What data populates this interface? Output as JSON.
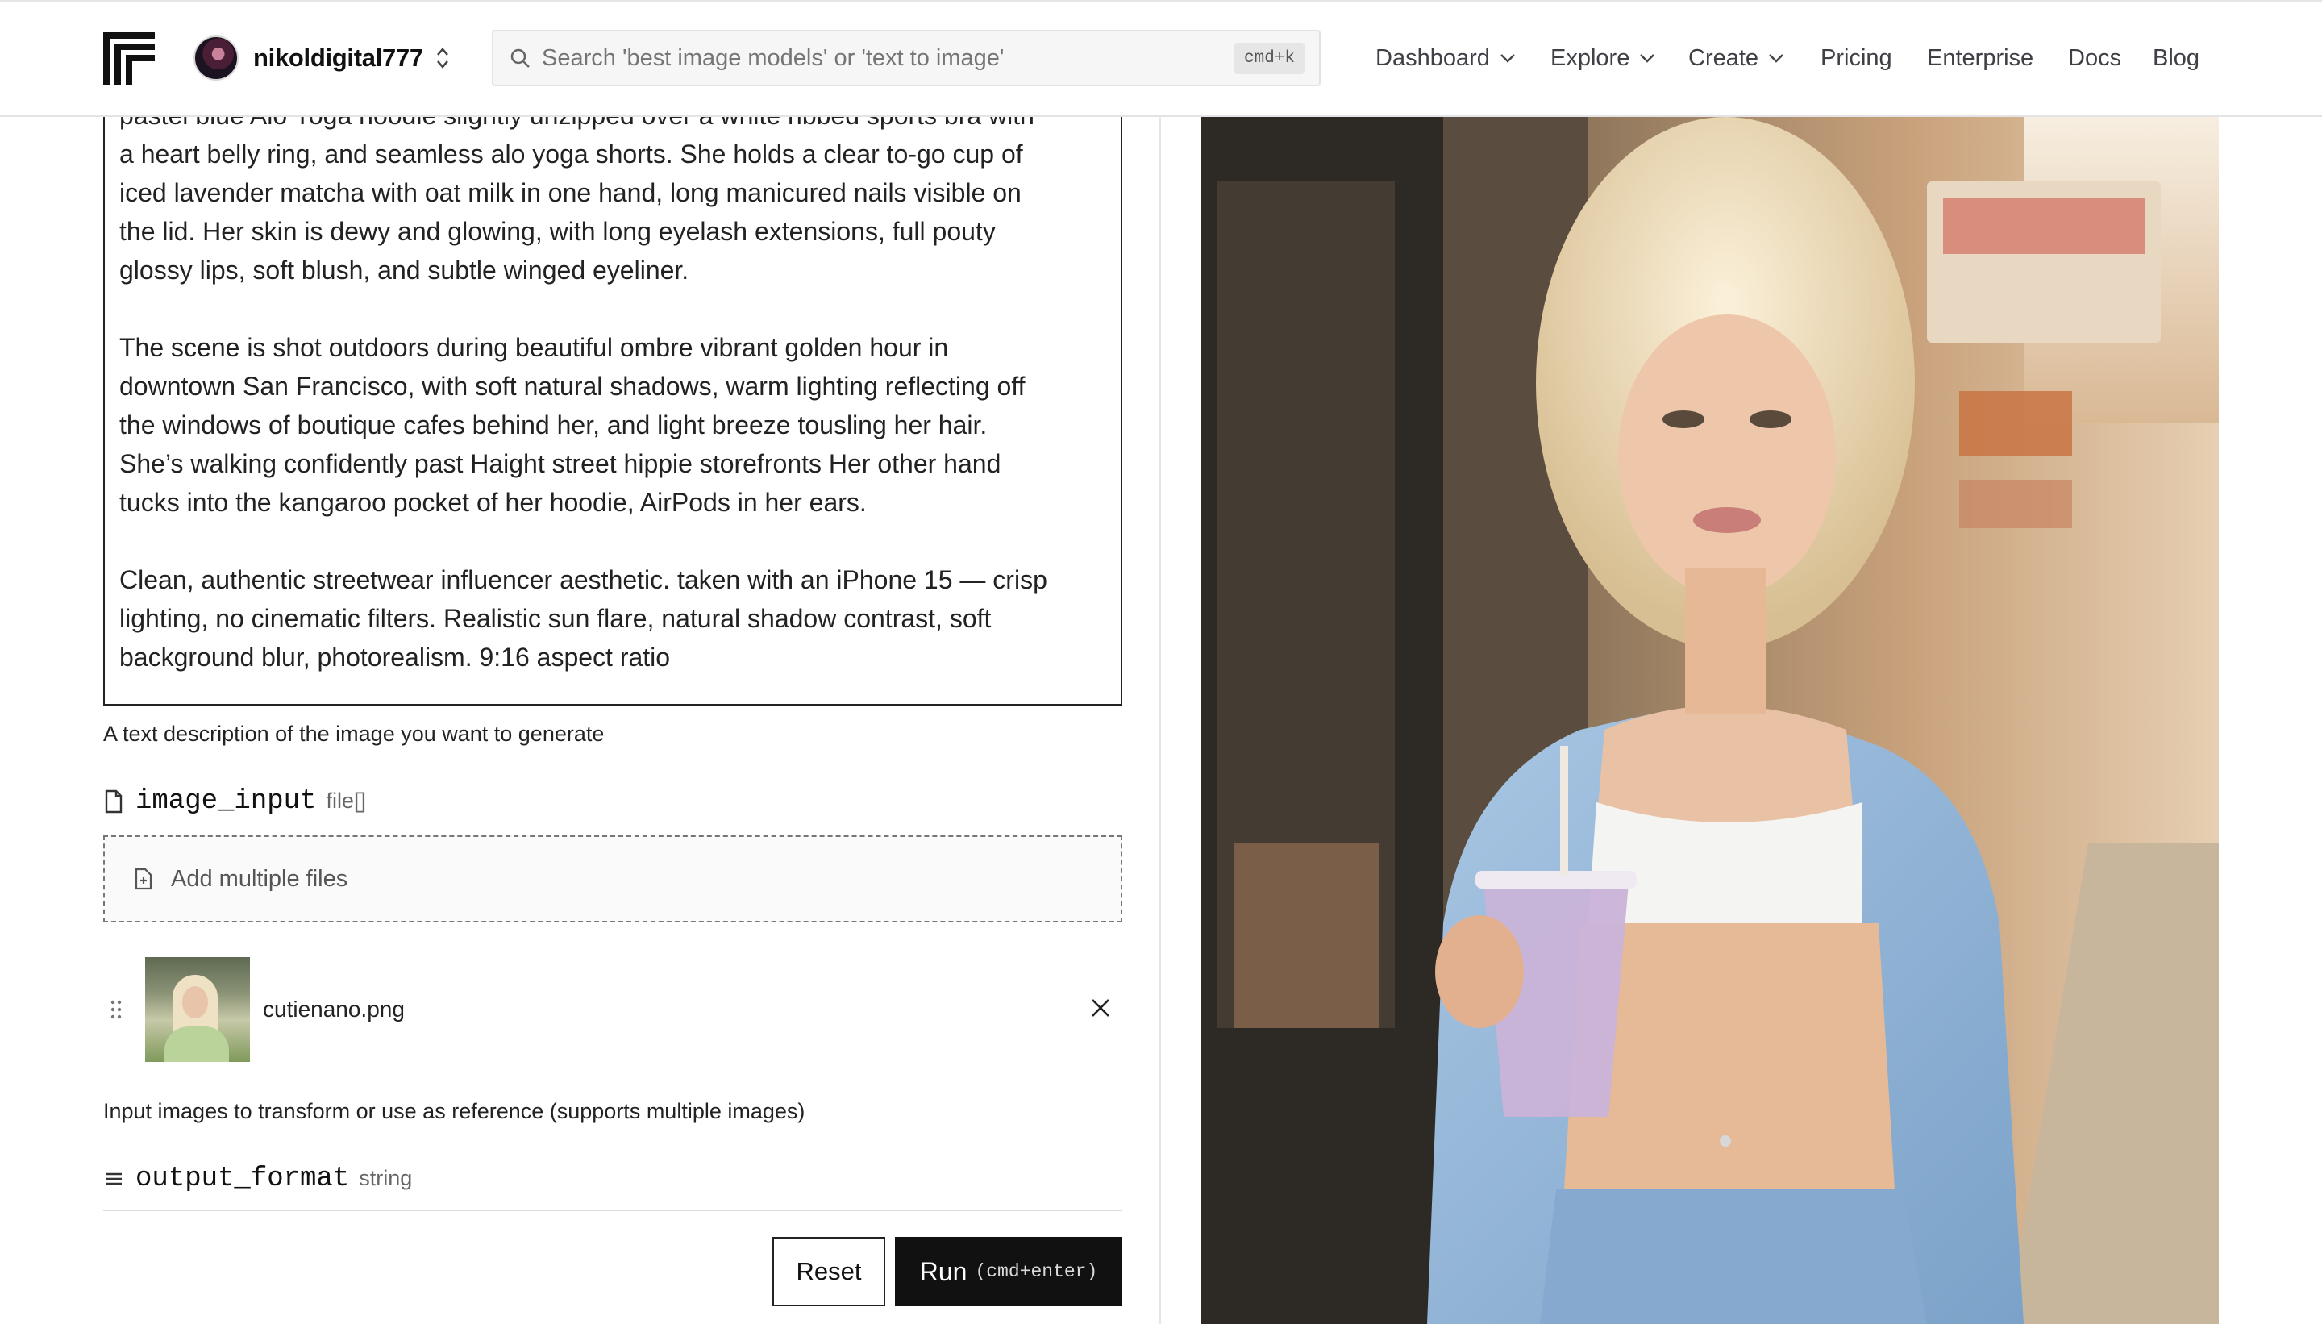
{
  "header": {
    "username": "nikoldigital777",
    "search_placeholder": "Search 'best image models' or 'text to image'",
    "search_shortcut": "cmd+k",
    "nav": [
      {
        "label": "Dashboard",
        "dropdown": true
      },
      {
        "label": "Explore",
        "dropdown": true
      },
      {
        "label": "Create",
        "dropdown": true
      },
      {
        "label": "Pricing",
        "dropdown": false
      },
      {
        "label": "Enterprise",
        "dropdown": false
      },
      {
        "label": "Docs",
        "dropdown": false
      },
      {
        "label": "Blog",
        "dropdown": false
      }
    ]
  },
  "form": {
    "prompt_value": "pastel blue Alo Yoga hoodie slightly unzipped over a white ribbed sports bra with\na heart belly ring, and seamless alo yoga shorts. She holds a clear to-go cup of\niced lavender matcha with oat milk in one hand, long manicured nails visible on\nthe lid. Her skin is dewy and glowing, with long eyelash extensions, full pouty\nglossy lips, soft blush, and subtle winged eyeliner.\n\nThe scene is shot outdoors during beautiful ombre vibrant golden hour in\ndowntown San Francisco, with soft natural shadows, warm lighting reflecting off\nthe windows of boutique cafes behind her, and light breeze tousling her hair.\nShe’s walking confidently past Haight street hippie storefronts Her other hand\ntucks into the kangaroo pocket of her hoodie, AirPods in her ears.\n\nClean, authentic streetwear influencer aesthetic. taken with an iPhone 15 — crisp\nlighting, no cinematic filters. Realistic sun flare, natural shadow contrast, soft\nbackground blur, photorealism. 9:16 aspect ratio",
    "prompt_hint": "A text description of the image you want to generate",
    "image_input": {
      "name": "image_input",
      "type": "file[]",
      "dropzone_label": "Add multiple files",
      "files": [
        {
          "name": "cutienano.png"
        }
      ],
      "hint": "Input images to transform or use as reference (supports multiple images)"
    },
    "output_format": {
      "name": "output_format",
      "type": "string"
    },
    "reset_label": "Reset",
    "run_label": "Run",
    "run_shortcut": "(cmd+enter)"
  },
  "icons": {
    "logo": "replicate-logo-icon",
    "search": "search-icon",
    "file": "file-icon",
    "add_file": "file-plus-icon",
    "drag": "drag-handle-icon",
    "remove": "close-icon",
    "menu": "list-icon"
  },
  "colors": {
    "primary_button": "#111111",
    "border": "#222222",
    "hoodie": "#8fb3d6"
  }
}
